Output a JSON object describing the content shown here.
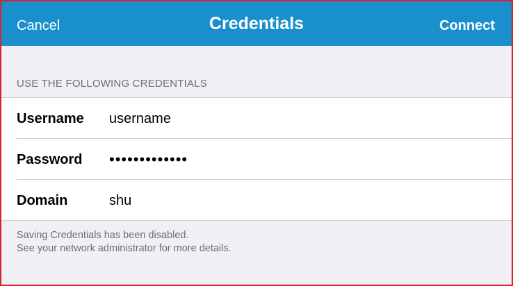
{
  "nav": {
    "cancel_label": "Cancel",
    "title": "Credentials",
    "connect_label": "Connect"
  },
  "section": {
    "header": "USE THE FOLLOWING CREDENTIALS"
  },
  "fields": [
    {
      "label": "Username",
      "value": "username"
    },
    {
      "label": "Password",
      "value": "•••••••••••••"
    },
    {
      "label": "Domain",
      "value": "shu"
    }
  ],
  "footer": {
    "line1": "Saving Credentials has been disabled.",
    "line2": "See your network administrator for more details."
  },
  "colors": {
    "nav_background": "#1a8fcd",
    "page_background": "#efeff4",
    "frame_border": "#d7262b"
  }
}
